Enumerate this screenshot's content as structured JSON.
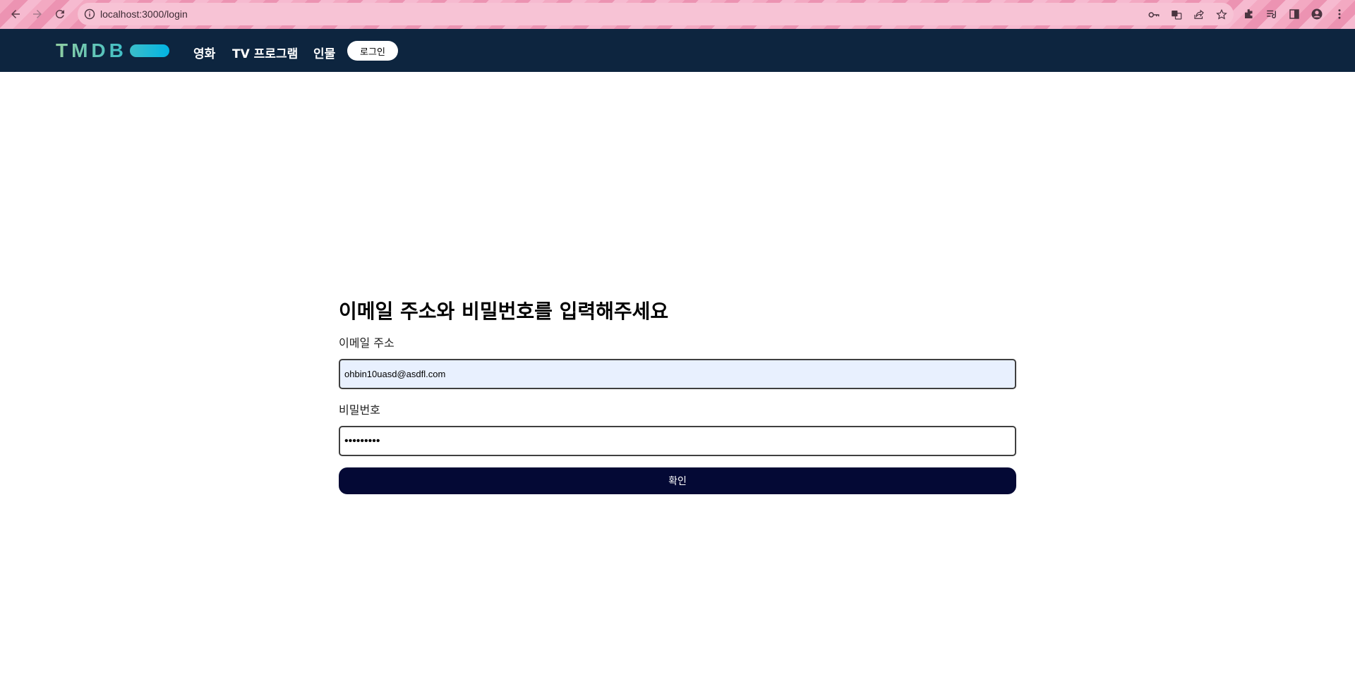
{
  "browser": {
    "url": "localhost:3000/login",
    "icons": [
      "back-icon",
      "forward-icon",
      "reload-icon",
      "site-info-icon",
      "key-icon",
      "translate-icon",
      "share-icon",
      "star-icon",
      "extensions-icon",
      "reading-list-icon",
      "side-panel-icon",
      "profile-icon",
      "menu-icon"
    ]
  },
  "header": {
    "logo_text": "TMDB",
    "nav": [
      "영화",
      "TV 프로그램",
      "인물"
    ],
    "login_label": "로그인"
  },
  "form": {
    "title": "이메일 주소와 비밀번호를 입력해주세요",
    "email_label": "이메일 주소",
    "email_value": "ohbin10uasd@asdfl.com",
    "password_label": "비밀번호",
    "password_value": "•••••••••",
    "submit_label": "확인"
  },
  "colors": {
    "header_bg": "#0d253f",
    "submit_bg": "#040935",
    "autofill_bg": "#e8f0fe",
    "browser_theme": "#f3a9c2"
  }
}
